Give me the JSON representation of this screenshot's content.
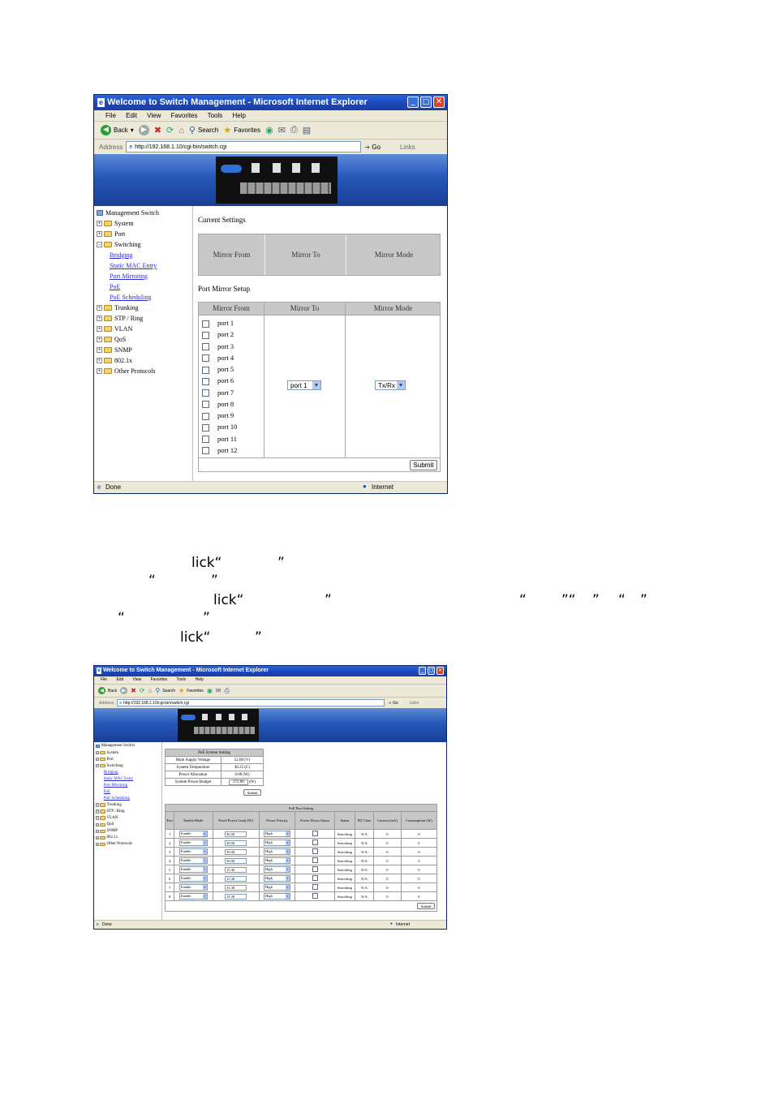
{
  "window1": {
    "title": "Welcome to Switch Management - Microsoft Internet Explorer",
    "menu": [
      "File",
      "Edit",
      "View",
      "Favorites",
      "Tools",
      "Help"
    ],
    "toolbar": {
      "back": "Back",
      "search": "Search",
      "favorites": "Favorites"
    },
    "address": {
      "label": "Address",
      "url": "http://192.168.1.10/cgi-bin/switch.cgi",
      "go": "Go",
      "links": "Links"
    },
    "tree": {
      "root": "Management Switch",
      "items": [
        {
          "label": "System",
          "type": "folder"
        },
        {
          "label": "Port",
          "type": "folder"
        },
        {
          "label": "Switching",
          "type": "open-folder"
        },
        {
          "label": "Bridging",
          "type": "link"
        },
        {
          "label": "Static MAC Entry",
          "type": "link"
        },
        {
          "label": "Port Mirroring",
          "type": "link"
        },
        {
          "label": "PoE",
          "type": "link"
        },
        {
          "label": "PoE Scheduling",
          "type": "link"
        },
        {
          "label": "Trunking",
          "type": "folder"
        },
        {
          "label": "STP / Ring",
          "type": "folder"
        },
        {
          "label": "VLAN",
          "type": "folder"
        },
        {
          "label": "QoS",
          "type": "folder"
        },
        {
          "label": "SNMP",
          "type": "folder"
        },
        {
          "label": "802.1x",
          "type": "folder"
        },
        {
          "label": "Other Protocols",
          "type": "folder"
        }
      ]
    },
    "current_settings": {
      "title": "Current Settings",
      "headers": [
        "Mirror From",
        "Mirror To",
        "Mirror Mode"
      ]
    },
    "setup": {
      "title": "Port Mirror Setup",
      "headers": [
        "Mirror From",
        "Mirror To",
        "Mirror Mode"
      ],
      "ports": [
        "port 1",
        "port 2",
        "port 3",
        "port 4",
        "port 5",
        "port 6",
        "port 7",
        "port 8",
        "port 9",
        "port 10",
        "port 11",
        "port 12"
      ],
      "mirror_to_value": "port 1",
      "mirror_mode_value": "Tx/Rx",
      "submit": "Submit"
    },
    "status": {
      "left": "Done",
      "right": "Internet"
    }
  },
  "body_text": {
    "line1": "lick“",
    "line1_close": "”",
    "line2_open": "“",
    "line2_close": "”",
    "line3": "lick“",
    "line3_close": "”",
    "line3_q1": "“",
    "line3_q2": "”“",
    "line3_q3": "”",
    "line3_q4": "“",
    "line3_q5": "”",
    "line4_open": "“",
    "line4_close": "”",
    "line5": "lick“",
    "line5_close": "”"
  },
  "window2": {
    "title": "Welcome to Switch Management - Microsoft Internet Explorer",
    "menu": [
      "File",
      "Edit",
      "View",
      "Favorites",
      "Tools",
      "Help"
    ],
    "toolbar": {
      "back": "Back",
      "search": "Search",
      "favorites": "Favorites"
    },
    "address": {
      "label": "Address",
      "url": "http://192.168.1.10/cgi-bin/switch.cgi",
      "go": "Go",
      "links": "Links"
    },
    "tree": {
      "root": "Management Switch",
      "items": [
        {
          "label": "System",
          "type": "folder"
        },
        {
          "label": "Port",
          "type": "folder"
        },
        {
          "label": "Switching",
          "type": "open-folder"
        },
        {
          "label": "Bridging",
          "type": "link"
        },
        {
          "label": "Static MAC Entry",
          "type": "link"
        },
        {
          "label": "Port Mirroring",
          "type": "link"
        },
        {
          "label": "PoE",
          "type": "link"
        },
        {
          "label": "PoE Scheduling",
          "type": "link"
        },
        {
          "label": "Trunking",
          "type": "folder"
        },
        {
          "label": "STP / Ring",
          "type": "folder"
        },
        {
          "label": "VLAN",
          "type": "folder"
        },
        {
          "label": "QoS",
          "type": "folder"
        },
        {
          "label": "SNMP",
          "type": "folder"
        },
        {
          "label": "802.1x",
          "type": "folder"
        },
        {
          "label": "Other Protocols",
          "type": "folder"
        }
      ]
    },
    "poe_system": {
      "title": "PoE System Setting",
      "rows": [
        {
          "label": "Main Supply Voltage",
          "value": "52.00 (V)"
        },
        {
          "label": "System Temperature",
          "value": "46.25 (C)"
        },
        {
          "label": "Power Allocation",
          "value": "0.00 (W)"
        },
        {
          "label": "System Power Budget",
          "value": "375.00",
          "unit": "(W)"
        }
      ],
      "submit": "Submit"
    },
    "poe_port": {
      "title": "PoE Port Setting",
      "headers": [
        "Port",
        "Enable Mode",
        "Fixed Power Limit (W)",
        "Power Priority",
        "Power Down Alarm",
        "Status",
        "PD Class",
        "Current (mA)",
        "Consumption (W)"
      ],
      "rows": [
        {
          "port": "1",
          "mode": "Enable",
          "limit": "30.00",
          "priority": "High",
          "status": "Searching",
          "pd": "N/A",
          "current": "0",
          "consumption": "0"
        },
        {
          "port": "2",
          "mode": "Enable",
          "limit": "30.00",
          "priority": "High",
          "status": "Searching",
          "pd": "N/A",
          "current": "0",
          "consumption": "0"
        },
        {
          "port": "3",
          "mode": "Enable",
          "limit": "30.00",
          "priority": "High",
          "status": "Searching",
          "pd": "N/A",
          "current": "0",
          "consumption": "0"
        },
        {
          "port": "4",
          "mode": "Enable",
          "limit": "30.00",
          "priority": "High",
          "status": "Searching",
          "pd": "N/A",
          "current": "0",
          "consumption": "0"
        },
        {
          "port": "5",
          "mode": "Enable",
          "limit": "15.38",
          "priority": "High",
          "status": "Searching",
          "pd": "N/A",
          "current": "0",
          "consumption": "0"
        },
        {
          "port": "6",
          "mode": "Enable",
          "limit": "15.38",
          "priority": "High",
          "status": "Searching",
          "pd": "N/A",
          "current": "0",
          "consumption": "0"
        },
        {
          "port": "7",
          "mode": "Enable",
          "limit": "15.38",
          "priority": "High",
          "status": "Searching",
          "pd": "N/A",
          "current": "0",
          "consumption": "0"
        },
        {
          "port": "8",
          "mode": "Enable",
          "limit": "15.38",
          "priority": "High",
          "status": "Searching",
          "pd": "N/A",
          "current": "0",
          "consumption": "0"
        }
      ],
      "submit": "Submit"
    },
    "status": {
      "left": "Done",
      "right": "Internet"
    }
  }
}
